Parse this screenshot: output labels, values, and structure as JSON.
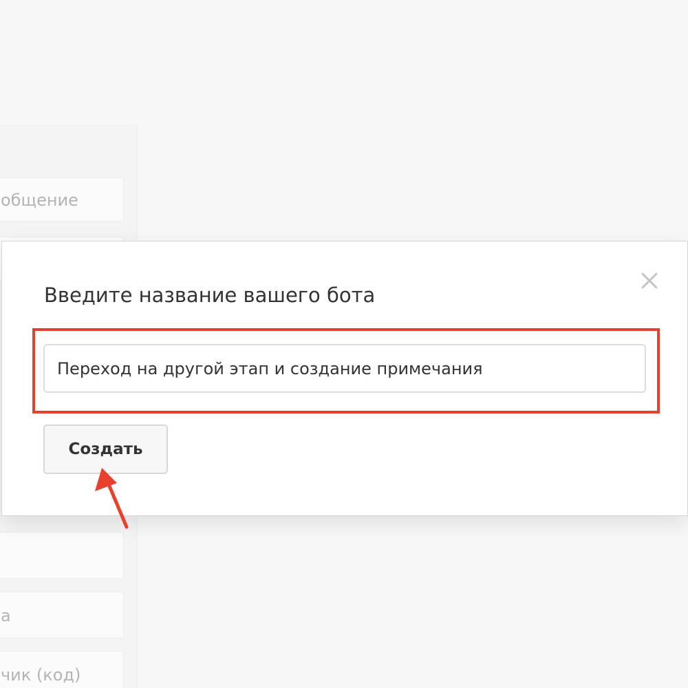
{
  "background": {
    "items": [
      {
        "label": "общение"
      },
      {
        "label": ""
      },
      {
        "label": "а"
      },
      {
        "label": "чик (код)"
      }
    ]
  },
  "dialog": {
    "title": "Введите название вашего бота",
    "name_input_value": "Переход на другой этап и создание примечания",
    "create_button_label": "Создать",
    "close_icon": "close-icon"
  },
  "annotation": {
    "highlight_color": "#e8402c",
    "arrow_color": "#e8402c",
    "arrow_icon": "arrow-up-icon"
  }
}
